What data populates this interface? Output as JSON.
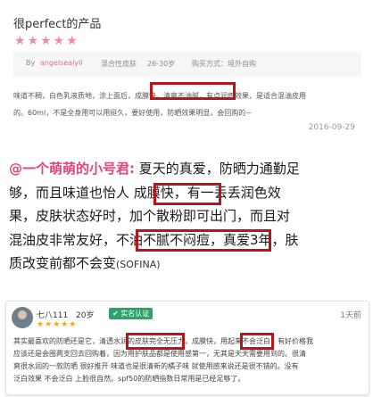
{
  "review": {
    "title": "很perfect的产品",
    "stars": "★★★★★",
    "by_label": "By",
    "username": "angelsealyll",
    "skin_type": "混合性皮肤",
    "age_range": "26-30岁",
    "purchase_label": "购买方式：境外自购",
    "body_lines": [
      "味道不稠，白色乳液质地，涂上面后，成膜快，清爽不油腻，有点润色效果，是适合混油皮用",
      "的。60ml，不是全身用可以用挺久，要好使用，防晒效果明显，会回购的~"
    ],
    "date": "2016-09-29"
  },
  "quote": {
    "username": "@一个萌萌的小号君:",
    "line1_rest": " 夏天的真爱，防晒力通勤足",
    "line2": "够，而且味道也怡人 成膜快，有一丢丢润色效",
    "line3": "果，皮肤状态好时，加个散粉即可出门，而且对",
    "line4": "混油皮非常友好，不油不腻不闷痘，真爱3年，肤",
    "line5": "质改变前都不会变",
    "brand": "(SOFINA)"
  },
  "comment": {
    "username": "七八111",
    "age": "20岁",
    "badge": "✔ 实名认证",
    "stars": "★★★★★",
    "time": "1天前",
    "body_lines": [
      "其实最喜欢的防晒还是它，清透水润的皮肤完全无压力，成膜快，用起来不会泛白，有好价格我",
      "应该还是会囤两支回去回购着，因为用护肤品都是使用感第一，无其是天天需要用到的。很清",
      "爽很水润的一款防晒 很好推开 味道也是很清新的橘子味 就使用感来说还是很不错的。没有",
      "泛白效果 不会泛白 上脸很自然。spf50的防晒指数日常用是已经足够了。"
    ]
  }
}
